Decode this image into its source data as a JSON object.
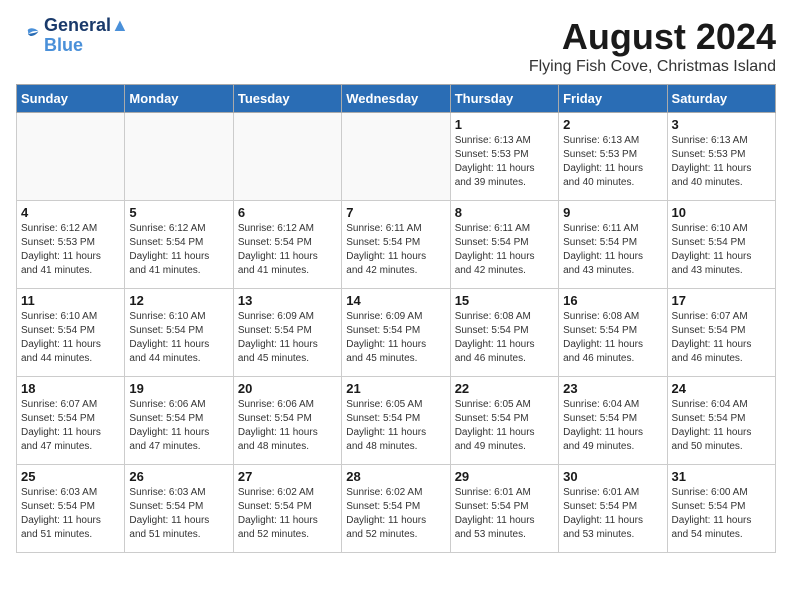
{
  "logo": {
    "line1": "General",
    "line2": "Blue"
  },
  "title": {
    "month_year": "August 2024",
    "location": "Flying Fish Cove, Christmas Island"
  },
  "days_of_week": [
    "Sunday",
    "Monday",
    "Tuesday",
    "Wednesday",
    "Thursday",
    "Friday",
    "Saturday"
  ],
  "weeks": [
    [
      {
        "day": "",
        "info": ""
      },
      {
        "day": "",
        "info": ""
      },
      {
        "day": "",
        "info": ""
      },
      {
        "day": "",
        "info": ""
      },
      {
        "day": "1",
        "info": "Sunrise: 6:13 AM\nSunset: 5:53 PM\nDaylight: 11 hours\nand 39 minutes."
      },
      {
        "day": "2",
        "info": "Sunrise: 6:13 AM\nSunset: 5:53 PM\nDaylight: 11 hours\nand 40 minutes."
      },
      {
        "day": "3",
        "info": "Sunrise: 6:13 AM\nSunset: 5:53 PM\nDaylight: 11 hours\nand 40 minutes."
      }
    ],
    [
      {
        "day": "4",
        "info": "Sunrise: 6:12 AM\nSunset: 5:53 PM\nDaylight: 11 hours\nand 41 minutes."
      },
      {
        "day": "5",
        "info": "Sunrise: 6:12 AM\nSunset: 5:54 PM\nDaylight: 11 hours\nand 41 minutes."
      },
      {
        "day": "6",
        "info": "Sunrise: 6:12 AM\nSunset: 5:54 PM\nDaylight: 11 hours\nand 41 minutes."
      },
      {
        "day": "7",
        "info": "Sunrise: 6:11 AM\nSunset: 5:54 PM\nDaylight: 11 hours\nand 42 minutes."
      },
      {
        "day": "8",
        "info": "Sunrise: 6:11 AM\nSunset: 5:54 PM\nDaylight: 11 hours\nand 42 minutes."
      },
      {
        "day": "9",
        "info": "Sunrise: 6:11 AM\nSunset: 5:54 PM\nDaylight: 11 hours\nand 43 minutes."
      },
      {
        "day": "10",
        "info": "Sunrise: 6:10 AM\nSunset: 5:54 PM\nDaylight: 11 hours\nand 43 minutes."
      }
    ],
    [
      {
        "day": "11",
        "info": "Sunrise: 6:10 AM\nSunset: 5:54 PM\nDaylight: 11 hours\nand 44 minutes."
      },
      {
        "day": "12",
        "info": "Sunrise: 6:10 AM\nSunset: 5:54 PM\nDaylight: 11 hours\nand 44 minutes."
      },
      {
        "day": "13",
        "info": "Sunrise: 6:09 AM\nSunset: 5:54 PM\nDaylight: 11 hours\nand 45 minutes."
      },
      {
        "day": "14",
        "info": "Sunrise: 6:09 AM\nSunset: 5:54 PM\nDaylight: 11 hours\nand 45 minutes."
      },
      {
        "day": "15",
        "info": "Sunrise: 6:08 AM\nSunset: 5:54 PM\nDaylight: 11 hours\nand 46 minutes."
      },
      {
        "day": "16",
        "info": "Sunrise: 6:08 AM\nSunset: 5:54 PM\nDaylight: 11 hours\nand 46 minutes."
      },
      {
        "day": "17",
        "info": "Sunrise: 6:07 AM\nSunset: 5:54 PM\nDaylight: 11 hours\nand 46 minutes."
      }
    ],
    [
      {
        "day": "18",
        "info": "Sunrise: 6:07 AM\nSunset: 5:54 PM\nDaylight: 11 hours\nand 47 minutes."
      },
      {
        "day": "19",
        "info": "Sunrise: 6:06 AM\nSunset: 5:54 PM\nDaylight: 11 hours\nand 47 minutes."
      },
      {
        "day": "20",
        "info": "Sunrise: 6:06 AM\nSunset: 5:54 PM\nDaylight: 11 hours\nand 48 minutes."
      },
      {
        "day": "21",
        "info": "Sunrise: 6:05 AM\nSunset: 5:54 PM\nDaylight: 11 hours\nand 48 minutes."
      },
      {
        "day": "22",
        "info": "Sunrise: 6:05 AM\nSunset: 5:54 PM\nDaylight: 11 hours\nand 49 minutes."
      },
      {
        "day": "23",
        "info": "Sunrise: 6:04 AM\nSunset: 5:54 PM\nDaylight: 11 hours\nand 49 minutes."
      },
      {
        "day": "24",
        "info": "Sunrise: 6:04 AM\nSunset: 5:54 PM\nDaylight: 11 hours\nand 50 minutes."
      }
    ],
    [
      {
        "day": "25",
        "info": "Sunrise: 6:03 AM\nSunset: 5:54 PM\nDaylight: 11 hours\nand 51 minutes."
      },
      {
        "day": "26",
        "info": "Sunrise: 6:03 AM\nSunset: 5:54 PM\nDaylight: 11 hours\nand 51 minutes."
      },
      {
        "day": "27",
        "info": "Sunrise: 6:02 AM\nSunset: 5:54 PM\nDaylight: 11 hours\nand 52 minutes."
      },
      {
        "day": "28",
        "info": "Sunrise: 6:02 AM\nSunset: 5:54 PM\nDaylight: 11 hours\nand 52 minutes."
      },
      {
        "day": "29",
        "info": "Sunrise: 6:01 AM\nSunset: 5:54 PM\nDaylight: 11 hours\nand 53 minutes."
      },
      {
        "day": "30",
        "info": "Sunrise: 6:01 AM\nSunset: 5:54 PM\nDaylight: 11 hours\nand 53 minutes."
      },
      {
        "day": "31",
        "info": "Sunrise: 6:00 AM\nSunset: 5:54 PM\nDaylight: 11 hours\nand 54 minutes."
      }
    ]
  ]
}
